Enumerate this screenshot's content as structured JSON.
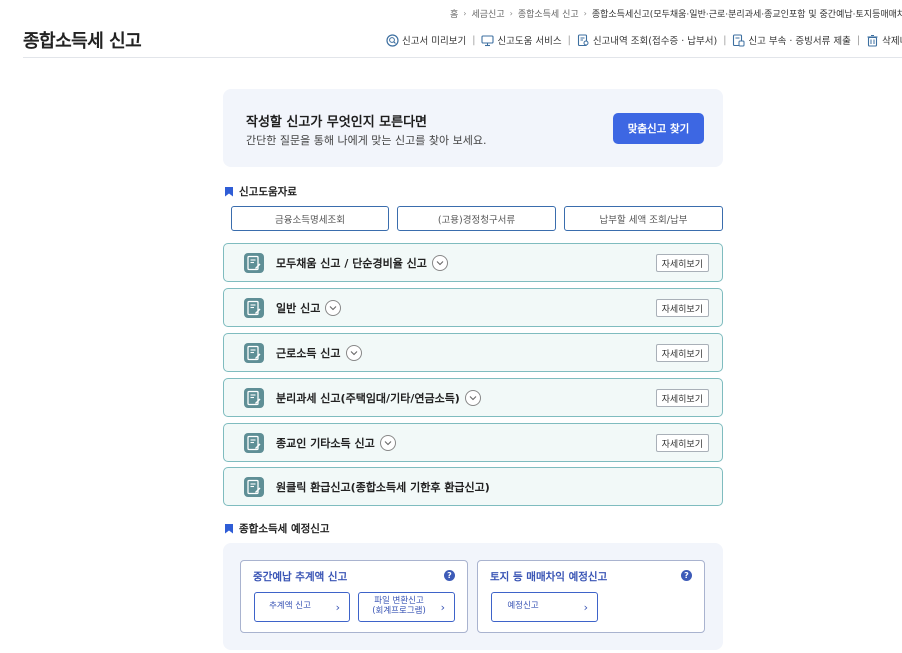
{
  "breadcrumb": [
    {
      "label": "홈"
    },
    {
      "label": "세금신고"
    },
    {
      "label": "종합소득세 신고"
    },
    {
      "label": "종합소득세신고(모두채움·일반·근로·분리과세·종교인포함 및 중간예납·토지등매매차익"
    }
  ],
  "header": {
    "title": "종합소득세 신고",
    "links": [
      {
        "label": "신고서 미리보기",
        "icon": "magnifier-icon"
      },
      {
        "label": "신고도움 서비스",
        "icon": "monitor-icon"
      },
      {
        "label": "신고내역 조회(접수증 · 납부서)",
        "icon": "document-search-icon"
      },
      {
        "label": "신고 부속 · 증빙서류 제출",
        "icon": "document-upload-icon"
      },
      {
        "label": "삭제내역",
        "icon": "trash-icon"
      }
    ]
  },
  "promo": {
    "title": "작성할 신고가 무엇인지 모른다면",
    "subtitle": "간단한 질문을 통해 나에게 맞는 신고를 찾아 보세요.",
    "button": "맞춤신고 찾기"
  },
  "help_section": {
    "heading": "신고도움자료",
    "buttons": [
      "금융소득명세조회",
      "(고용)경정청구서류",
      "납부할 세액 조회/납부"
    ]
  },
  "filing_items": [
    {
      "label": "모두채움 신고 / 단순경비율 신고",
      "expandable": true,
      "detail": "자세히보기"
    },
    {
      "label": "일반 신고",
      "expandable": true,
      "detail": "자세히보기"
    },
    {
      "label": "근로소득 신고",
      "expandable": true,
      "detail": "자세히보기"
    },
    {
      "label": "분리과세 신고(주택임대/기타/연금소득)",
      "expandable": true,
      "detail": "자세히보기"
    },
    {
      "label": "종교인 기타소득 신고",
      "expandable": true,
      "detail": "자세히보기"
    },
    {
      "label": "원클릭 환급신고(종합소득세 기한후 환급신고)",
      "expandable": false
    }
  ],
  "estimate_section": {
    "heading": "종합소득세 예정신고",
    "cards": [
      {
        "title": "중간예납 추계액 신고",
        "help": "?",
        "buttons": [
          {
            "label": "추계액 신고",
            "arrow": "›"
          },
          {
            "label": "파일 변환신고\n(회계프로그램)",
            "arrow": "›"
          }
        ]
      },
      {
        "title": "토지 등 매매차익 예정신고",
        "help": "?",
        "buttons": [
          {
            "label": "예정신고",
            "arrow": "›"
          }
        ]
      }
    ]
  },
  "colors": {
    "primary": "#3d67e3",
    "accordion_border": "#7fbcbf",
    "accordion_bg": "#f2f9f8",
    "icon_teal": "#5f8f96",
    "panel_bg": "#f2f5fb",
    "estimate_text": "#3a55b5"
  }
}
